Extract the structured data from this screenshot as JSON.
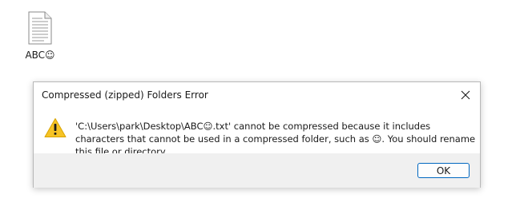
{
  "desktop": {
    "file_icon": "text-document-icon",
    "file_label": "ABC☺"
  },
  "dialog": {
    "title": "Compressed (zipped) Folders Error",
    "close_icon": "close-icon",
    "warning_icon": "warning-icon",
    "message": "'C:\\Users\\park\\Desktop\\ABC☺.txt' cannot be compressed because it includes characters that cannot be used in a compressed folder, such as ☺. You should rename this file or directory.",
    "ok_label": "OK",
    "warning_color": "#f4c430",
    "accent_color": "#0067c0"
  }
}
